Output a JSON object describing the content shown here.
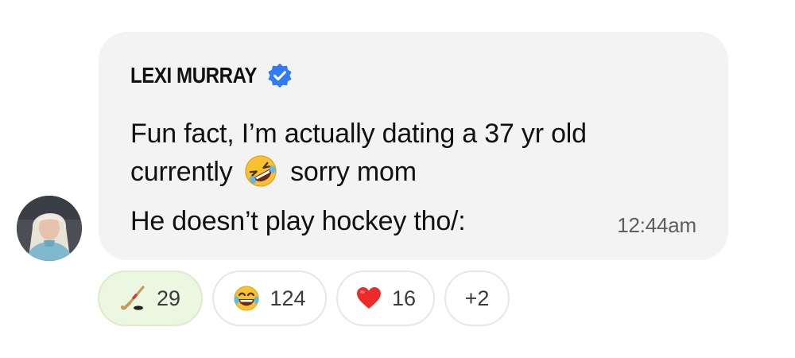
{
  "message": {
    "author": "LEXI MURRAY",
    "verified": true,
    "lines": [
      "Fun fact, I’m actually dating a 37 yr old",
      "currently",
      "sorry mom",
      "He doesn’t play hockey tho/:"
    ],
    "inline_emoji": "rolling-on-floor-laughing",
    "timestamp": "12:44am"
  },
  "reactions": [
    {
      "icon": "hockey-stick-icon",
      "count": "29",
      "selected": true
    },
    {
      "icon": "tears-of-joy-icon",
      "count": "124",
      "selected": false
    },
    {
      "icon": "red-heart-icon",
      "count": "16",
      "selected": false
    },
    {
      "icon": "",
      "count": "+2",
      "selected": false
    }
  ],
  "colors": {
    "bubble": "#f3f3f4",
    "verified": "#2f7cf6",
    "selected_reaction": "#ecf7e2"
  }
}
